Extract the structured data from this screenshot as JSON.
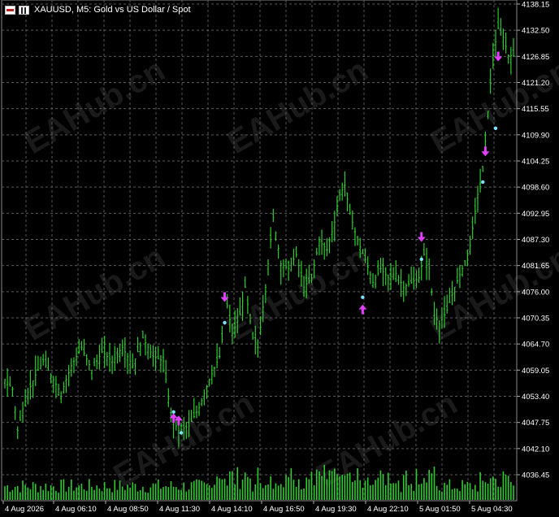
{
  "header": {
    "symbol_title": "XAUUSD, M5:  Gold vs US Dollar / Spot"
  },
  "watermark": "EAHub.cn",
  "colors": {
    "background": "#000000",
    "grid": "#5a5a5a",
    "candle": "#2ecc2e",
    "volume": "#2ecc2e",
    "signal_arrow": "#e040fb",
    "signal_dot": "#7fe3ff",
    "axis_text": "#ffffff"
  },
  "chart_data": {
    "type": "line",
    "price_ticks": [
      "4138.15",
      "4132.50",
      "4126.85",
      "4121.20",
      "4115.55",
      "4109.90",
      "4104.25",
      "4098.60",
      "4092.95",
      "4087.30",
      "4081.65",
      "4076.00",
      "4070.35",
      "4064.70",
      "4059.05",
      "4053.40",
      "4047.75",
      "4042.10",
      "4036.45"
    ],
    "time_ticks": [
      "4 Aug 2026",
      "4 Aug 06:10",
      "4 Aug 08:50",
      "4 Aug 11:30",
      "4 Aug 14:10",
      "4 Aug 16:50",
      "4 Aug 19:30",
      "4 Aug 22:10",
      "5 Aug 01:50",
      "5 Aug 04:30"
    ],
    "ylim": [
      4033.6,
      4138.15
    ],
    "price_series_anchors": [
      [
        0,
        4057
      ],
      [
        3,
        4055
      ],
      [
        5,
        4046
      ],
      [
        8,
        4053
      ],
      [
        12,
        4058
      ],
      [
        15,
        4061
      ],
      [
        18,
        4058
      ],
      [
        22,
        4054
      ],
      [
        26,
        4060
      ],
      [
        30,
        4064
      ],
      [
        34,
        4059
      ],
      [
        38,
        4063
      ],
      [
        42,
        4061
      ],
      [
        46,
        4064
      ],
      [
        50,
        4060
      ],
      [
        54,
        4066
      ],
      [
        58,
        4062
      ],
      [
        62,
        4061
      ],
      [
        65,
        4049
      ],
      [
        68,
        4046
      ],
      [
        72,
        4047
      ],
      [
        76,
        4051
      ],
      [
        80,
        4057
      ],
      [
        84,
        4062
      ],
      [
        87,
        4073
      ],
      [
        89,
        4067
      ],
      [
        92,
        4071
      ],
      [
        94,
        4077
      ],
      [
        97,
        4066
      ],
      [
        99,
        4064
      ],
      [
        102,
        4077
      ],
      [
        105,
        4092
      ],
      [
        108,
        4082
      ],
      [
        111,
        4081
      ],
      [
        114,
        4084
      ],
      [
        117,
        4077
      ],
      [
        120,
        4079
      ],
      [
        123,
        4087
      ],
      [
        126,
        4085
      ],
      [
        129,
        4091
      ],
      [
        131,
        4097
      ],
      [
        133,
        4099
      ],
      [
        135,
        4093
      ],
      [
        138,
        4087
      ],
      [
        141,
        4083
      ],
      [
        144,
        4078
      ],
      [
        147,
        4081
      ],
      [
        150,
        4079
      ],
      [
        153,
        4080
      ],
      [
        156,
        4077
      ],
      [
        159,
        4078
      ],
      [
        162,
        4079
      ],
      [
        164,
        4084
      ],
      [
        166,
        4081
      ],
      [
        168,
        4071
      ],
      [
        170,
        4069
      ],
      [
        173,
        4072
      ],
      [
        176,
        4077
      ],
      [
        179,
        4081
      ],
      [
        182,
        4086
      ],
      [
        185,
        4097
      ],
      [
        187,
        4102
      ],
      [
        189,
        4115
      ],
      [
        191,
        4127
      ],
      [
        193,
        4133
      ],
      [
        195,
        4131
      ],
      [
        197,
        4127
      ],
      [
        199,
        4127
      ]
    ],
    "signals": [
      {
        "type": "buy",
        "bar": 66,
        "price": 4048.5
      },
      {
        "type": "buy",
        "bar": 68,
        "price": 4048.0
      },
      {
        "type": "sell",
        "bar": 86,
        "price": 4075.0
      },
      {
        "type": "buy",
        "bar": 140,
        "price": 4072.0
      },
      {
        "type": "sell",
        "bar": 163,
        "price": 4088.0
      },
      {
        "type": "sell",
        "bar": 188,
        "price": 4106.5
      },
      {
        "type": "sell",
        "bar": 193,
        "price": 4127.0
      }
    ],
    "signal_dots": [
      {
        "bar": 66,
        "price": 4050.0
      },
      {
        "bar": 69,
        "price": 4045.5
      },
      {
        "bar": 86,
        "price": 4069.3
      },
      {
        "bar": 140,
        "price": 4074.8
      },
      {
        "bar": 163,
        "price": 4083.0
      },
      {
        "bar": 187,
        "price": 4099.7
      },
      {
        "bar": 192,
        "price": 4111.3
      }
    ],
    "bars": 200,
    "grid": true
  }
}
